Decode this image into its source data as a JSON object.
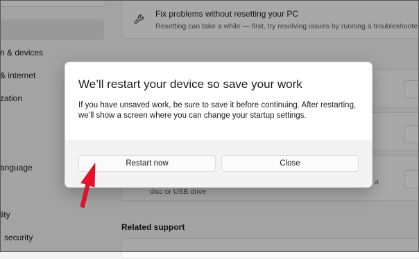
{
  "sidebar": {
    "items": [
      {
        "label": "n & devices"
      },
      {
        "label": "& internet"
      },
      {
        "label": "zation"
      },
      {
        "label": "anguage"
      },
      {
        "label": "lity"
      },
      {
        "label": "security"
      }
    ]
  },
  "main": {
    "fix_card": {
      "title": "Fix problems without resetting your PC",
      "description": "Resetting can take a while — first, try resolving issues by running a troubleshooter",
      "icon": "wrench-icon"
    },
    "partial_texts": {
      "a": "a",
      "disc": "disc or USB drive"
    },
    "related_support": "Related support"
  },
  "dialog": {
    "title": "We’ll restart your device so save your work",
    "body": "If you have unsaved work, be sure to save it before continuing. After restarting, we’ll show a screen where you can change your startup settings.",
    "buttons": {
      "restart": "Restart now",
      "close": "Close"
    }
  },
  "annotation": {
    "arrow_color": "#e8102a"
  }
}
